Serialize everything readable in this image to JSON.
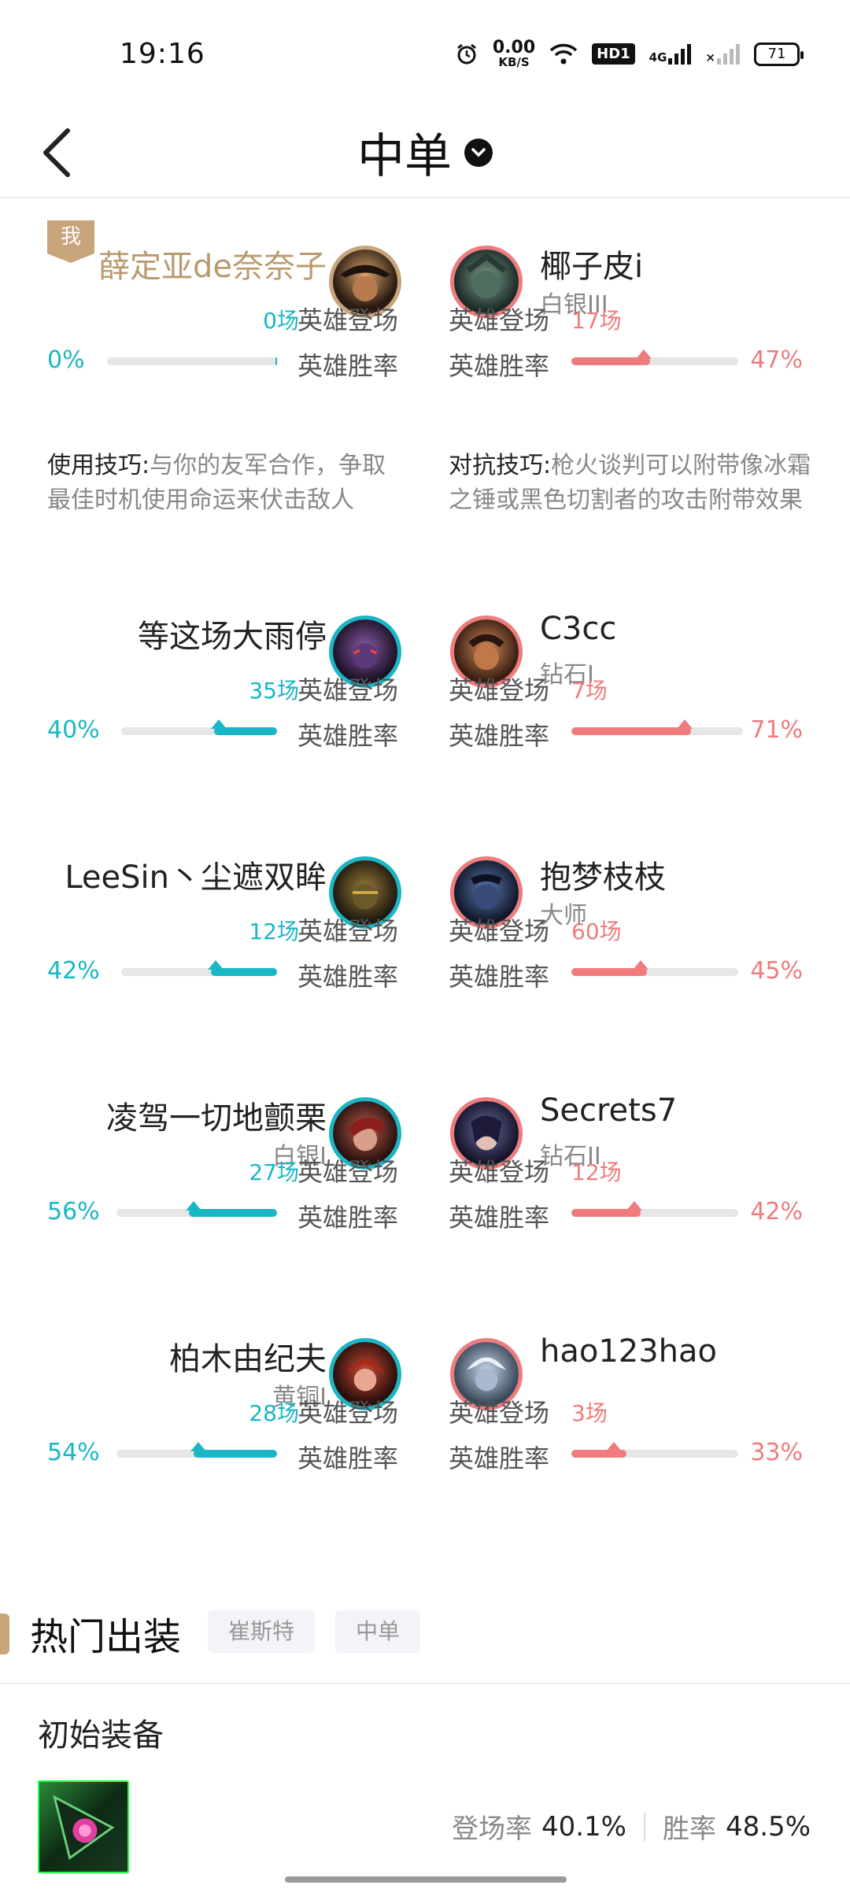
{
  "status_bar": {
    "time": "19:16",
    "net_speed_value": "0.00",
    "net_speed_unit": "KB/S",
    "hd_label": "HD1",
    "net_label": "4G",
    "battery": "71"
  },
  "header": {
    "title": "中单",
    "back_icon": "chevron-left-icon",
    "dropdown_icon": "chevron-down-circle-icon"
  },
  "labels": {
    "appear": "英雄登场",
    "winrate": "英雄胜率",
    "me_badge": "我"
  },
  "colors": {
    "ally": "#19b7c5",
    "enemy": "#ef7b7d",
    "me": "#c7a47a"
  },
  "matchups": [
    {
      "left": {
        "name": "薛定亚de奈奈子",
        "rank": "",
        "games": "0场",
        "rate": "0%",
        "rate_value": 0,
        "is_me": true,
        "tip_label": "使用技巧:",
        "tip_text": "与你的友军合作，争取最佳时机使用命运来伏击敌人"
      },
      "right": {
        "name": "椰子皮i",
        "rank": "白银III",
        "games": "17场",
        "rate": "47%",
        "rate_value": 47,
        "tip_label": "对抗技巧:",
        "tip_text": "枪火谈判可以附带像冰霜之锤或黑色切割者的攻击附带效果"
      }
    },
    {
      "left": {
        "name": "等这场大雨停",
        "rank": "",
        "games": "35场",
        "rate": "40%",
        "rate_value": 40
      },
      "right": {
        "name": "C3cc",
        "rank": "钻石I",
        "games": "7场",
        "rate": "71%",
        "rate_value": 71
      }
    },
    {
      "left": {
        "name": "LeeSin丶尘遮双眸",
        "rank": "",
        "games": "12场",
        "rate": "42%",
        "rate_value": 42
      },
      "right": {
        "name": "抱梦枝枝",
        "rank": "大师",
        "games": "60场",
        "rate": "45%",
        "rate_value": 45
      }
    },
    {
      "left": {
        "name": "凌驾一切地颤栗",
        "rank": "白银I",
        "games": "27场",
        "rate": "56%",
        "rate_value": 56
      },
      "right": {
        "name": "Secrets7",
        "rank": "钻石II",
        "games": "12场",
        "rate": "42%",
        "rate_value": 42
      }
    },
    {
      "left": {
        "name": "柏木由纪夫",
        "rank": "黄铜I",
        "games": "28场",
        "rate": "54%",
        "rate_value": 54
      },
      "right": {
        "name": "hao123hao",
        "rank": "",
        "games": "3场",
        "rate": "33%",
        "rate_value": 33
      }
    }
  ],
  "hot_builds": {
    "title": "热门出装",
    "chips": [
      "崔斯特",
      "中单"
    ],
    "section": "初始装备",
    "item_icon": "dark-seal-item-icon",
    "appear_label": "登场率",
    "appear_value": "40.1%",
    "win_label": "胜率",
    "win_value": "48.5%"
  }
}
